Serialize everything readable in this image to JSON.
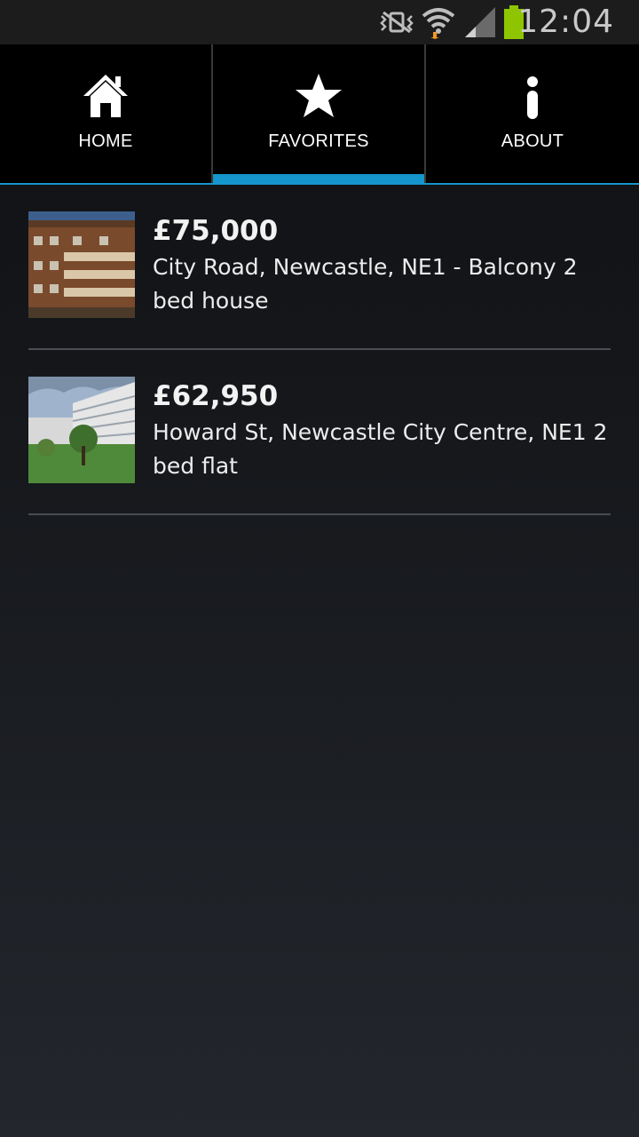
{
  "status_bar": {
    "time": "12:04",
    "icons": [
      "vibrate-icon",
      "wifi-icon",
      "signal-icon",
      "battery-icon"
    ]
  },
  "tabs": [
    {
      "label": "HOME",
      "icon": "home-icon",
      "selected": false
    },
    {
      "label": "FAVORITES",
      "icon": "star-icon",
      "selected": true
    },
    {
      "label": "ABOUT",
      "icon": "info-icon",
      "selected": false
    }
  ],
  "listings": [
    {
      "price": "£75,000",
      "address": "City Road, Newcastle, NE1 - Balcony 2 bed house"
    },
    {
      "price": "£62,950",
      "address": "Howard St, Newcastle City Centre, NE1 2 bed flat"
    }
  ],
  "colors": {
    "accent": "#1596cc",
    "background_top": "#0f1013",
    "background_bottom": "#23272d",
    "battery": "#8fc400"
  }
}
